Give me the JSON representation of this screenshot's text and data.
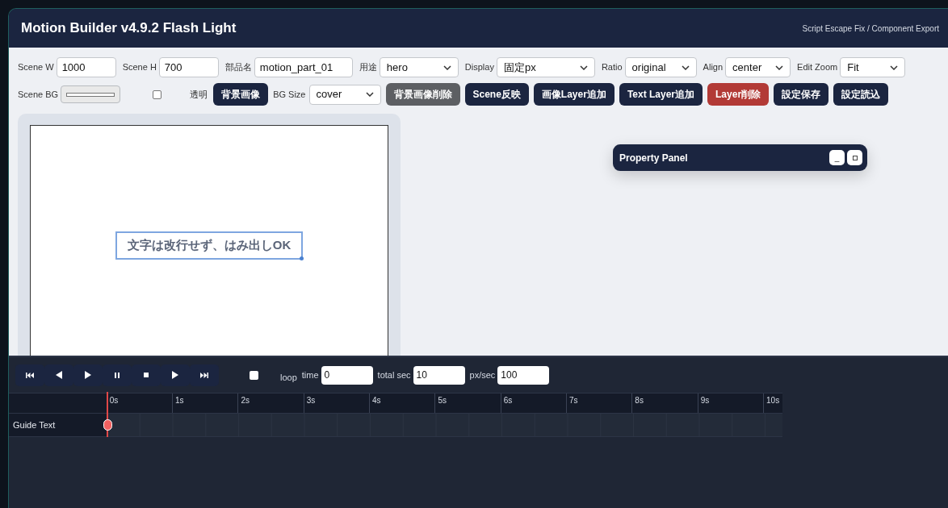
{
  "app": {
    "title": "Motion Builder v4.9.2 Flash Light",
    "subtitle": "Script Escape Fix / Component Export"
  },
  "row1": [
    {
      "kind": "input",
      "label": "Scene W",
      "value": "1000"
    },
    {
      "kind": "input",
      "label": "Scene H",
      "value": "700"
    },
    {
      "kind": "input",
      "label": "部品名",
      "value": "motion_part_01"
    },
    {
      "kind": "select",
      "label": "用途",
      "value": "hero"
    },
    {
      "kind": "select",
      "label": "Display",
      "value": "固定px"
    },
    {
      "kind": "select",
      "label": "Ratio",
      "value": "original"
    },
    {
      "kind": "select",
      "label": "Align",
      "value": "center"
    },
    {
      "kind": "select",
      "label": "Edit Zoom",
      "value": "Fit"
    }
  ],
  "scene_bg": {
    "label": "Scene BG",
    "transparent_checked": false,
    "transparent_label": "透明"
  },
  "row2": [
    {
      "kind": "button",
      "label": "背景画像",
      "disabled": false
    },
    {
      "kind": "select",
      "label": "BG Size",
      "value": "cover"
    },
    {
      "kind": "button",
      "label": "背景画像削除",
      "disabled": true
    },
    {
      "kind": "button",
      "label": "Scene反映",
      "disabled": false
    },
    {
      "kind": "button",
      "label": "画像Layer追加",
      "disabled": false
    },
    {
      "kind": "button",
      "label": "Text Layer追加",
      "disabled": false
    },
    {
      "kind": "danger_button",
      "label": "Layer削除",
      "disabled": false
    },
    {
      "kind": "button",
      "label": "設定保存",
      "disabled": false
    },
    {
      "kind": "button",
      "label": "設定読込",
      "disabled": false
    }
  ],
  "canvas": {
    "text_layer": "文字は改行せず、はみ出しOK",
    "selected": true
  },
  "property_panel": {
    "title": "Property Panel",
    "minimize": "_"
  },
  "transport": {
    "buttons": [
      {
        "kind": "first"
      },
      {
        "kind": "prev"
      },
      {
        "kind": "play"
      },
      {
        "kind": "pause"
      },
      {
        "kind": "stop"
      },
      {
        "kind": "next"
      },
      {
        "kind": "last"
      }
    ],
    "loop_checked": false,
    "loop_label": "loop",
    "fields": [
      {
        "label": "time",
        "value": "0"
      },
      {
        "label": "total sec",
        "value": "10"
      },
      {
        "label": "px/sec",
        "value": "100"
      }
    ]
  },
  "timeline": {
    "ticks": [
      "0s",
      "1s",
      "2s",
      "3s",
      "4s",
      "5s",
      "6s",
      "7s",
      "8s",
      "9s",
      "10s"
    ],
    "tracks": [
      {
        "name": "Guide Text"
      }
    ]
  }
}
